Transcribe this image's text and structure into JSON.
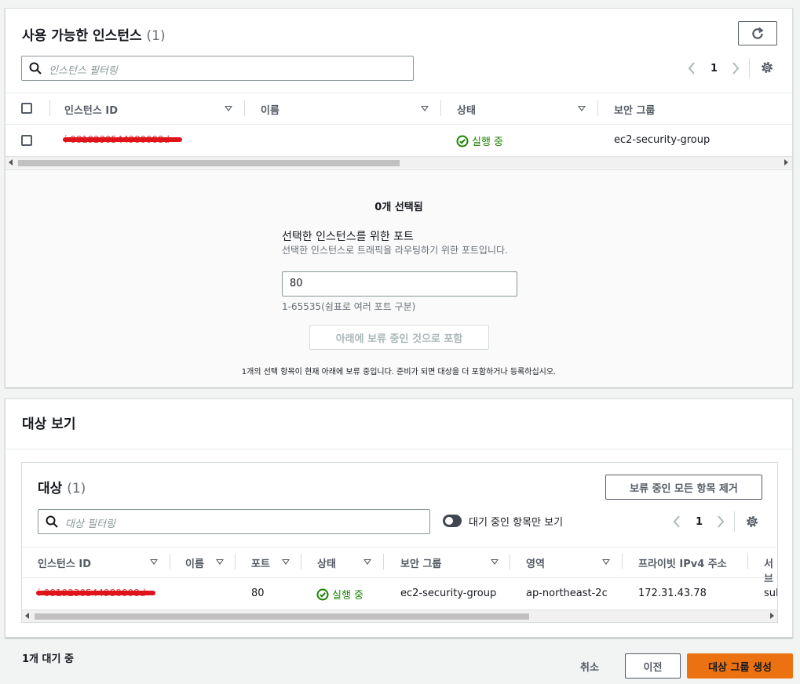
{
  "available": {
    "title": "사용 가능한 인스턴스",
    "count": "(1)",
    "filter_placeholder": "인스턴스 필터링",
    "page": "1",
    "columns": [
      "인스턴스 ID",
      "이름",
      "상태",
      "보안 그룹"
    ],
    "rows": [
      {
        "instance_id": "i-0819230544980008d",
        "name": "",
        "state": "실행 중",
        "security_group": "ec2-security-group"
      }
    ]
  },
  "selection": {
    "selected_count": "0개 선택됨",
    "port_label": "선택한 인스턴스를 위한 포트",
    "port_desc": "선택한 인스턴스로 트래픽을 라우팅하기 위한 포트입니다.",
    "port_value": "80",
    "port_hint": "1-65535(쉼표로 여러 포트 구분)",
    "include_button": "아래에 보류 중인 것으로 포함",
    "pending_note": "1개의 선택 항목이 현재 아래에 보류 중입니다. 준비가 되면 대상을 더 포함하거나 등록하십시오."
  },
  "review": {
    "title": "대상 보기",
    "targets_title": "대상",
    "targets_count": "(1)",
    "remove_all_button": "보류 중인 모든 항목 제거",
    "filter_placeholder": "대상 필터링",
    "toggle_label": "대기 중인 항목만 보기",
    "page": "1",
    "columns": [
      "인스턴스 ID",
      "이름",
      "포트",
      "상태",
      "보안 그룹",
      "영역",
      "프라이빗 IPv4 주소",
      "서브"
    ],
    "rows": [
      {
        "instance_id": "i-0819230544980008d",
        "name": "",
        "port": "80",
        "state": "실행 중",
        "security_group": "ec2-security-group",
        "zone": "ap-northeast-2c",
        "private_ip": "172.31.43.78",
        "subnet": "sub"
      }
    ]
  },
  "footer": {
    "pending": "1개 대기 중",
    "cancel": "취소",
    "previous": "이전",
    "create": "대상 그룹 생성"
  },
  "colors": {
    "accent": "#ec7211",
    "success": "#1d8102",
    "redaction": "#e0121a"
  }
}
